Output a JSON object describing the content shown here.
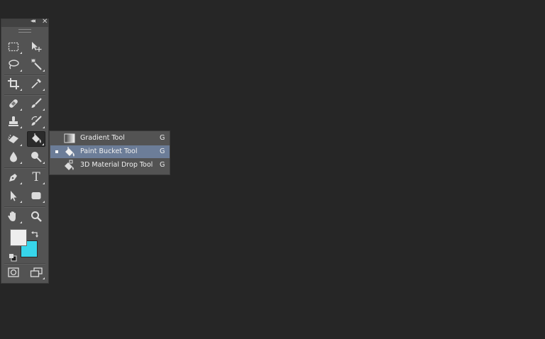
{
  "toolbar": {
    "collapse_glyph": "◂◂",
    "close_glyph": "✕",
    "tools": [
      {
        "name": "rectangular-marquee-tool",
        "icon": "marquee-icon"
      },
      {
        "name": "move-tool",
        "icon": "move-icon"
      },
      {
        "name": "lasso-tool",
        "icon": "lasso-icon"
      },
      {
        "name": "magic-wand-tool",
        "icon": "magic-wand-icon"
      },
      {
        "name": "crop-tool",
        "icon": "crop-icon"
      },
      {
        "name": "eyedropper-tool",
        "icon": "eyedropper-icon"
      },
      {
        "name": "spot-healing-brush-tool",
        "icon": "bandage-icon"
      },
      {
        "name": "brush-tool",
        "icon": "brush-icon"
      },
      {
        "name": "clone-stamp-tool",
        "icon": "stamp-icon"
      },
      {
        "name": "history-brush-tool",
        "icon": "history-brush-icon"
      },
      {
        "name": "eraser-tool",
        "icon": "eraser-icon"
      },
      {
        "name": "paint-bucket-tool",
        "icon": "paint-bucket-icon",
        "active": true
      },
      {
        "name": "blur-tool",
        "icon": "drop-icon"
      },
      {
        "name": "dodge-tool",
        "icon": "dodge-icon"
      },
      {
        "name": "pen-tool",
        "icon": "pen-icon"
      },
      {
        "name": "type-tool",
        "icon": "type-icon",
        "glyph": "T"
      },
      {
        "name": "path-selection-tool",
        "icon": "arrow-icon"
      },
      {
        "name": "rectangle-tool",
        "icon": "rectangle-shape-icon"
      },
      {
        "name": "hand-tool",
        "icon": "hand-icon"
      },
      {
        "name": "zoom-tool",
        "icon": "zoom-icon"
      },
      {
        "name": "quick-mask-mode",
        "icon": "quick-mask-icon"
      },
      {
        "name": "screen-mode",
        "icon": "screen-mode-icon"
      }
    ],
    "foreground_color": "#eeeeee",
    "background_color": "#37d5ea"
  },
  "flyout": {
    "items": [
      {
        "label": "Gradient Tool",
        "shortcut": "G",
        "icon": "gradient-icon",
        "selected": false
      },
      {
        "label": "Paint Bucket Tool",
        "shortcut": "G",
        "icon": "paint-bucket-icon",
        "selected": true
      },
      {
        "label": "3D Material Drop Tool",
        "shortcut": "G",
        "icon": "3d-material-drop-icon",
        "selected": false
      }
    ]
  },
  "colors": {
    "workspace": "#262626",
    "panel": "#535353",
    "selection_highlight": "#6c7d98"
  }
}
